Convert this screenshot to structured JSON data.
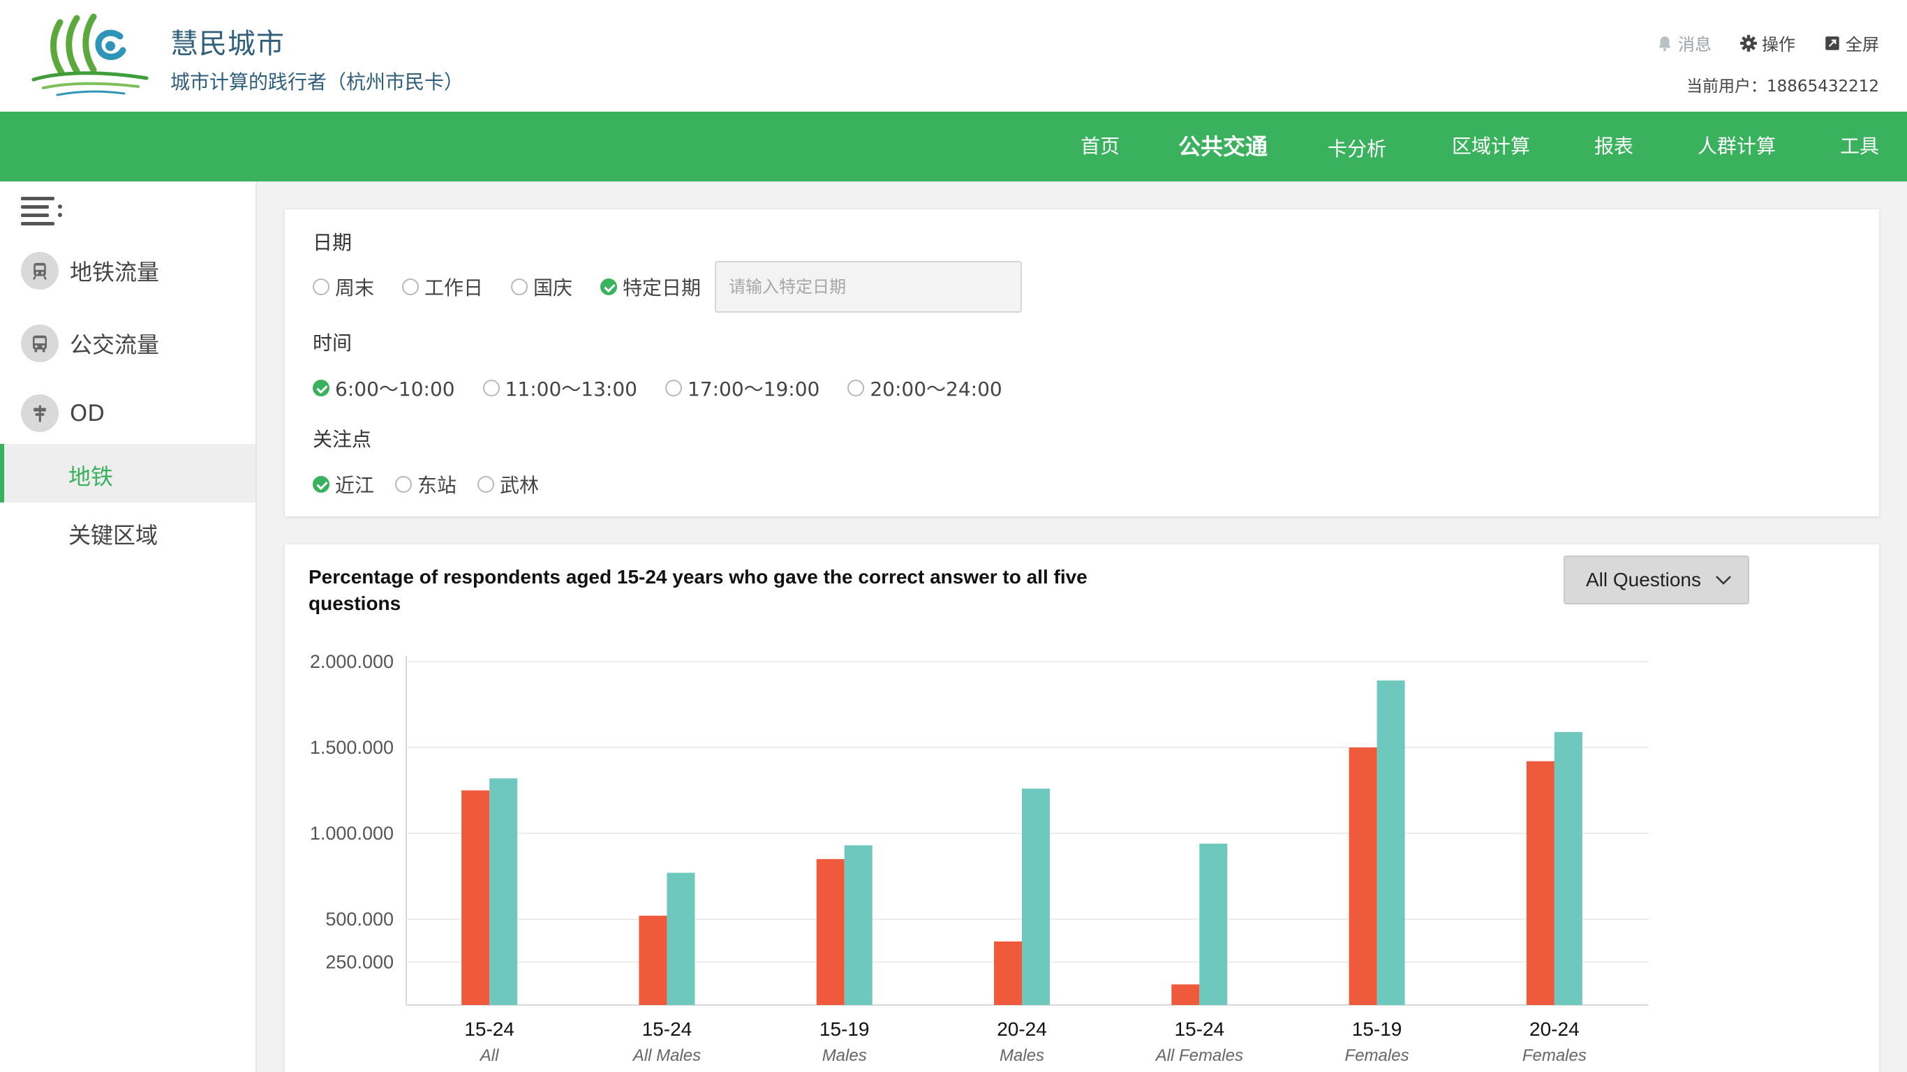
{
  "header": {
    "app_title": "慧民城市",
    "app_subtitle": "城市计算的践行者（杭州市民卡）",
    "actions": {
      "messages": "消息",
      "operate": "操作",
      "fullscreen": "全屏"
    },
    "current_user": "当前用户：18865432212"
  },
  "nav": {
    "items": [
      {
        "label": "首页"
      },
      {
        "label": "公共交通",
        "active": true
      },
      {
        "label": "卡分析"
      },
      {
        "label": "区域计算"
      },
      {
        "label": "报表"
      },
      {
        "label": "人群计算"
      },
      {
        "label": "工具"
      }
    ]
  },
  "sidebar": {
    "items": [
      {
        "label": "地铁流量",
        "icon": "subway-icon"
      },
      {
        "label": "公交流量",
        "icon": "bus-icon"
      },
      {
        "label": "OD",
        "icon": "signpost-icon"
      }
    ],
    "subitems": [
      {
        "label": "地铁",
        "active": true
      },
      {
        "label": "关键区域"
      }
    ]
  },
  "filters": {
    "date": {
      "label": "日期",
      "options": [
        "周末",
        "工作日",
        "国庆",
        "特定日期"
      ],
      "selected": "特定日期",
      "input_placeholder": "请输入特定日期",
      "input_value": ""
    },
    "time": {
      "label": "时间",
      "options": [
        "6:00～10:00",
        "11:00～13:00",
        "17:00～19:00",
        "20:00～24:00"
      ],
      "selected": "6:00～10:00"
    },
    "focus": {
      "label": "关注点",
      "options": [
        "近江",
        "东站",
        "武林"
      ],
      "selected": "近江"
    }
  },
  "chart_panel": {
    "dropdown_label": "All Questions"
  },
  "chart_data": {
    "type": "bar",
    "title": "Percentage of respondents aged 15-24 years who gave the correct answer to all five questions",
    "categories": [
      {
        "label": "15-24",
        "sublabel": "All"
      },
      {
        "label": "15-24",
        "sublabel": "All Males"
      },
      {
        "label": "15-19",
        "sublabel": "Males"
      },
      {
        "label": "20-24",
        "sublabel": "Males"
      },
      {
        "label": "15-24",
        "sublabel": "All Females"
      },
      {
        "label": "15-19",
        "sublabel": "Females"
      },
      {
        "label": "20-24",
        "sublabel": "Females"
      }
    ],
    "series": [
      {
        "color": "#ef5a3d",
        "values": [
          1250000,
          520000,
          850000,
          370000,
          120000,
          1500000,
          1420000
        ]
      },
      {
        "color": "#6ec8bd",
        "values": [
          1320000,
          770000,
          930000,
          1260000,
          940000,
          1890000,
          1590000
        ]
      }
    ],
    "yticks": [
      {
        "value": 250000,
        "label": "250.000"
      },
      {
        "value": 500000,
        "label": "500.000"
      },
      {
        "value": 1000000,
        "label": "1.000.000"
      },
      {
        "value": 1500000,
        "label": "1.500.000"
      },
      {
        "value": 2000000,
        "label": "2.000.000"
      }
    ],
    "ylim": [
      0,
      2000000
    ],
    "grid": true,
    "xlabel": "",
    "ylabel": ""
  }
}
